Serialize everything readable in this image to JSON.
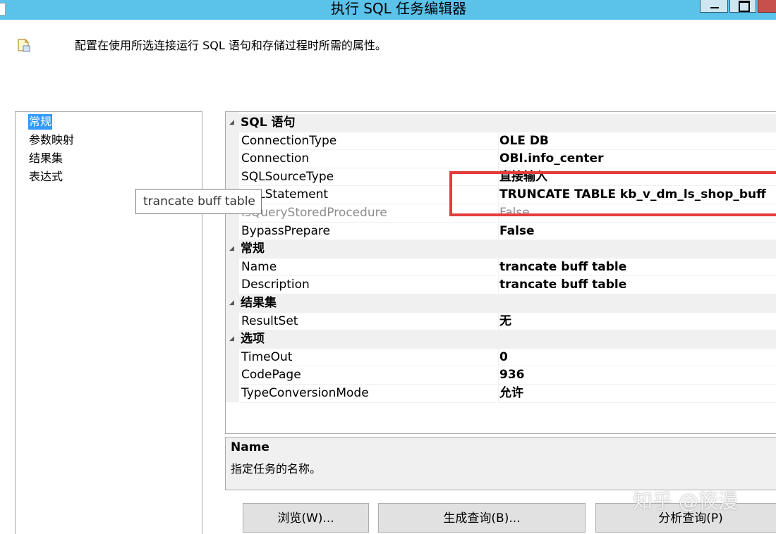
{
  "window": {
    "title": "执行 SQL 任务编辑器"
  },
  "header": {
    "description": "配置在使用所选连接运行 SQL 语句和存储过程时所需的属性。"
  },
  "nav": {
    "items": [
      {
        "label": "常规",
        "selected": true
      },
      {
        "label": "参数映射"
      },
      {
        "label": "结果集"
      },
      {
        "label": "表达式"
      }
    ]
  },
  "tooltip": {
    "text": "trancate buff table"
  },
  "grid": {
    "rows": [
      {
        "type": "category",
        "label": "SQL 语句"
      },
      {
        "type": "prop",
        "name": "ConnectionType",
        "value": "OLE DB"
      },
      {
        "type": "prop",
        "name": "Connection",
        "value": "OBI.info_center"
      },
      {
        "type": "prop",
        "name": "SQLSourceType",
        "value": "直接输入"
      },
      {
        "type": "prop",
        "name": "SQLStatement",
        "value": "TRUNCATE TABLE kb_v_dm_ls_shop_buff"
      },
      {
        "type": "prop",
        "name": "IsQueryStoredProcedure",
        "value": "False",
        "disabled": true
      },
      {
        "type": "prop",
        "name": "BypassPrepare",
        "value": "False"
      },
      {
        "type": "category",
        "label": "常规"
      },
      {
        "type": "prop",
        "name": "Name",
        "value": "trancate buff table"
      },
      {
        "type": "prop",
        "name": "Description",
        "value": "trancate buff table"
      },
      {
        "type": "category",
        "label": "结果集"
      },
      {
        "type": "prop",
        "name": "ResultSet",
        "value": "无"
      },
      {
        "type": "category",
        "label": "选项"
      },
      {
        "type": "prop",
        "name": "TimeOut",
        "value": "0"
      },
      {
        "type": "prop",
        "name": "CodePage",
        "value": "936"
      },
      {
        "type": "prop",
        "name": "TypeConversionMode",
        "value": "允许"
      }
    ]
  },
  "description_panel": {
    "title": "Name",
    "text": "指定任务的名称。"
  },
  "buttons": {
    "browse": "浏览(W)...",
    "build_query": "生成查询(B)...",
    "parse_query": "分析查询(P)"
  },
  "watermark": "知乎 @筱漫",
  "colors": {
    "titlebar": "#5bc2ea",
    "selection": "#3399ff",
    "highlight": "#e63b3b"
  }
}
